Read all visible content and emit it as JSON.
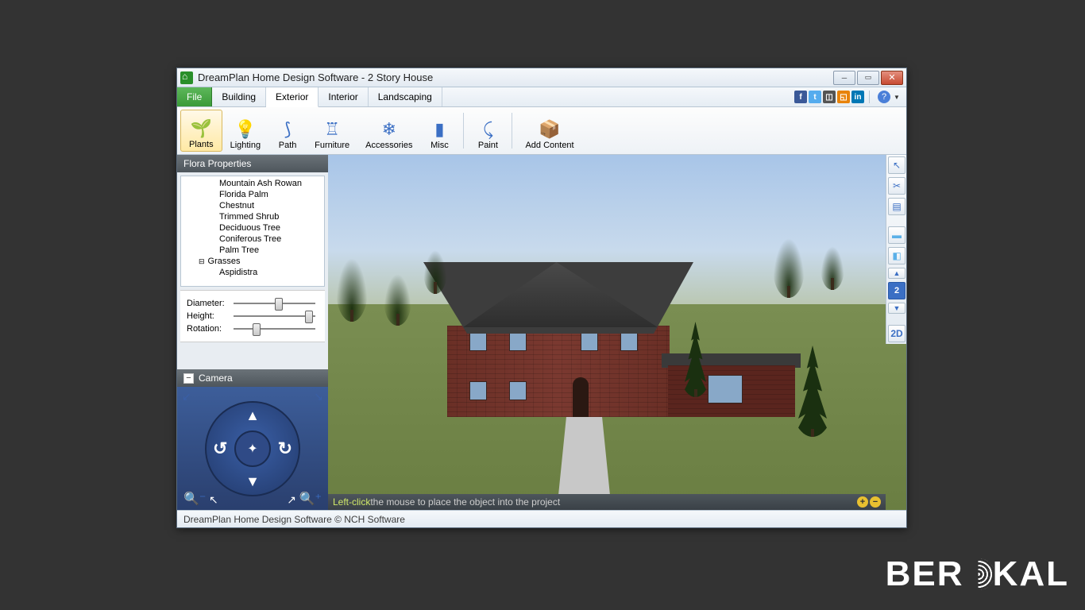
{
  "window": {
    "title": "DreamPlan Home Design Software - 2 Story House"
  },
  "menu": {
    "file": "File",
    "tabs": [
      "Building",
      "Exterior",
      "Interior",
      "Landscaping"
    ],
    "active_tab": "Exterior"
  },
  "ribbon": {
    "items": [
      {
        "label": "Plants",
        "icon": "plant-icon",
        "selected": true
      },
      {
        "label": "Lighting",
        "icon": "bulb-icon"
      },
      {
        "label": "Path",
        "icon": "path-icon"
      },
      {
        "label": "Furniture",
        "icon": "furniture-icon"
      },
      {
        "label": "Accessories",
        "icon": "accessories-icon"
      },
      {
        "label": "Misc",
        "icon": "misc-icon"
      }
    ],
    "items2": [
      {
        "label": "Paint",
        "icon": "paint-icon"
      }
    ],
    "items3": [
      {
        "label": "Add Content",
        "icon": "add-content-icon"
      }
    ]
  },
  "flora_panel": {
    "title": "Flora Properties",
    "tree": [
      "Mountain Ash Rowan",
      "Florida Palm",
      "Chestnut",
      "Trimmed Shrub",
      "Deciduous Tree",
      "Coniferous Tree",
      "Palm Tree"
    ],
    "group": "Grasses",
    "group_child": "Aspidistra",
    "sliders": {
      "diameter": {
        "label": "Diameter:",
        "value": 55
      },
      "height": {
        "label": "Height:",
        "value": 92
      },
      "rotation": {
        "label": "Rotation:",
        "value": 28
      }
    }
  },
  "camera_panel": {
    "title": "Camera"
  },
  "viewport_tools": {
    "floor": "2",
    "mode_2d": "2D"
  },
  "hint": {
    "highlight": "Left-click",
    "text": " the mouse to place the object into the project"
  },
  "status": "DreamPlan Home Design Software © NCH Software",
  "watermark": {
    "pre": "BER",
    "post": "KAL"
  }
}
